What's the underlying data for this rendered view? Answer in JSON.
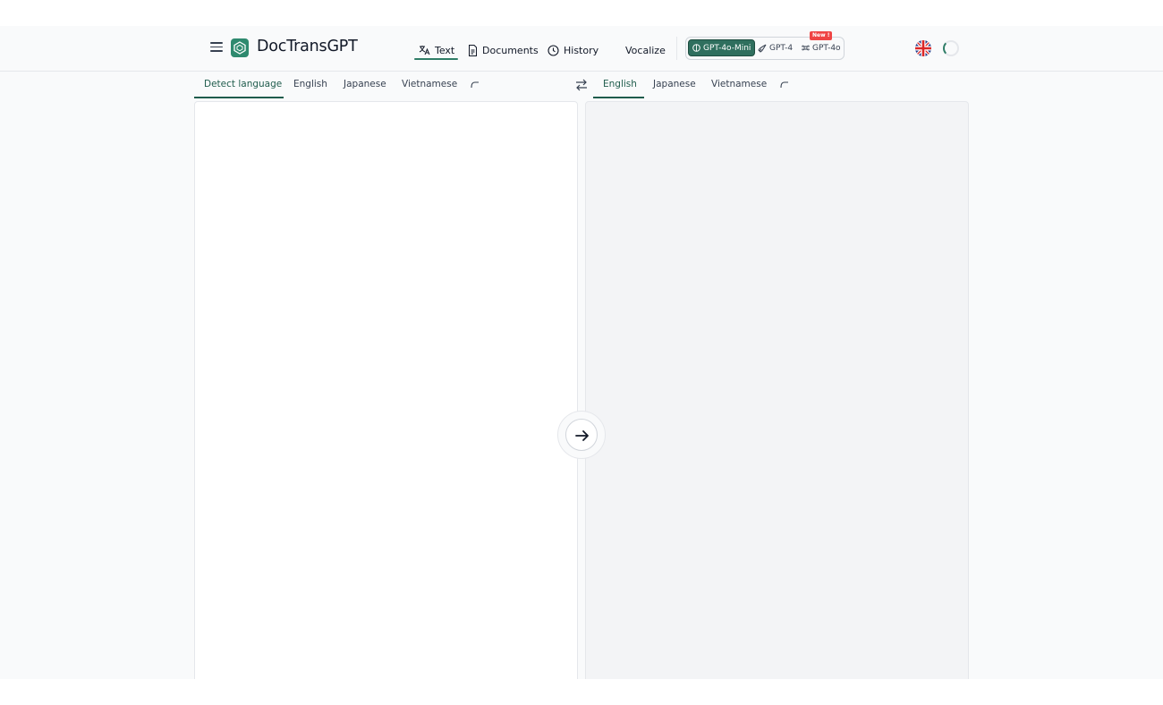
{
  "header": {
    "brand": "DocTransGPT",
    "nav": [
      {
        "label": "Text",
        "icon": "translate-icon",
        "active": true
      },
      {
        "label": "Documents",
        "icon": "document-icon",
        "active": false
      },
      {
        "label": "History",
        "icon": "clock-icon",
        "active": false
      },
      {
        "label": "Vocalize",
        "icon": "",
        "active": false
      }
    ],
    "models": [
      {
        "label": "GPT-4o-Mini",
        "icon": "brain-icon",
        "active": true
      },
      {
        "label": "GPT-4",
        "icon": "rocket-icon",
        "active": false
      },
      {
        "label": "GPT-4o",
        "icon": "command-icon",
        "active": false
      }
    ],
    "new_badge": "New !",
    "ui_language_icon": "uk-flag-icon"
  },
  "source": {
    "tabs": [
      "Detect language",
      "English",
      "Japanese",
      "Vietnamese"
    ],
    "active_tab": "Detect language",
    "text": ""
  },
  "target": {
    "tabs": [
      "English",
      "Japanese",
      "Vietnamese"
    ],
    "active_tab": "English",
    "text": ""
  },
  "colors": {
    "accent": "#2f7d67",
    "active_model_bg": "#2f6f5e",
    "badge": "#ef4444",
    "page_bg": "#f9fafb",
    "output_bg": "#f3f4f6"
  }
}
